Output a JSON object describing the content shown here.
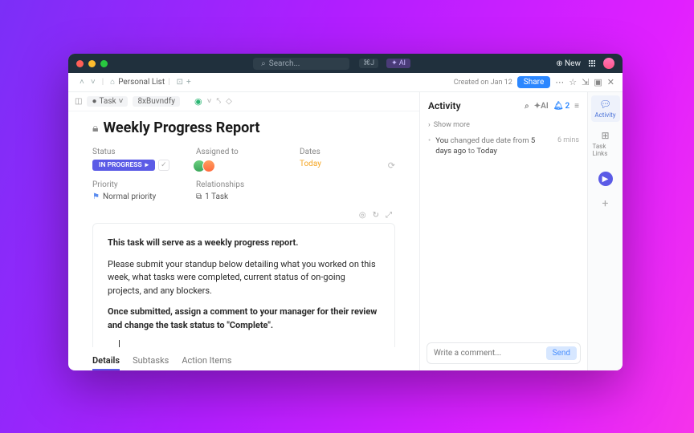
{
  "titlebar": {
    "search_placeholder": "Search...",
    "kbd": "⌘J",
    "ai": "AI",
    "new": "New"
  },
  "crumb": {
    "list": "Personal List",
    "created": "Created on Jan 12",
    "share": "Share"
  },
  "toolrow": {
    "task_label": "Task",
    "id": "8xBuvndfy"
  },
  "title": "Weekly Progress Report",
  "fields": {
    "status_label": "Status",
    "status_value": "IN PROGRESS",
    "assigned_label": "Assigned to",
    "dates_label": "Dates",
    "dates_value": "Today",
    "priority_label": "Priority",
    "priority_value": "Normal priority",
    "relationships_label": "Relationships",
    "relationships_value": "1 Task"
  },
  "description": {
    "p1": "This task will serve as a weekly progress report.",
    "p2": "Please submit your standup below detailing what you worked on this week, what tasks were completed, current status of on-going projects, and any blockers.",
    "p3": "Once submitted, assign a comment to your manager for their review and change the task status to \"Complete\"."
  },
  "tabs": {
    "details": "Details",
    "subtasks": "Subtasks",
    "actions": "Action Items"
  },
  "activity": {
    "heading": "Activity",
    "ai": "AI",
    "bell_count": "2",
    "show_more": "Show more",
    "item1_pre": "You",
    "item1_mid": " changed due date from ",
    "item1_from": "5 days ago",
    "item1_to_word": " to ",
    "item1_to": "Today",
    "item1_time": "6 mins",
    "comment_placeholder": "Write a comment...",
    "send": "Send"
  },
  "rail": {
    "activity": "Activity",
    "task_links": "Task Links"
  }
}
